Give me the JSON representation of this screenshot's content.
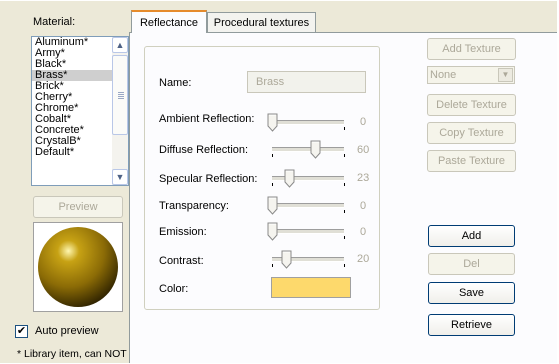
{
  "material": {
    "label": "Material:",
    "items": [
      {
        "label": "Aluminum*",
        "selected": false
      },
      {
        "label": "Army*",
        "selected": false
      },
      {
        "label": "Black*",
        "selected": false
      },
      {
        "label": "Brass*",
        "selected": true
      },
      {
        "label": "Brick*",
        "selected": false
      },
      {
        "label": "Cherry*",
        "selected": false
      },
      {
        "label": "Chrome*",
        "selected": false
      },
      {
        "label": "Cobalt*",
        "selected": false
      },
      {
        "label": "Concrete*",
        "selected": false
      },
      {
        "label": "CrystalB*",
        "selected": false
      },
      {
        "label": "Default*",
        "selected": false
      }
    ]
  },
  "preview": {
    "button": "Preview",
    "sphere_color": "#c7a214",
    "auto_preview_label": "Auto preview",
    "auto_preview_checked": true
  },
  "footnote": "* Library item, can NOT be edited.",
  "tabs": [
    {
      "label": "Reflectance",
      "active": true
    },
    {
      "label": "Procedural textures",
      "active": false
    }
  ],
  "reflectance": {
    "name_label": "Name:",
    "name_value": "Brass",
    "sliders": [
      {
        "label": "Ambient Reflection:",
        "value": "0",
        "fraction": 0.0
      },
      {
        "label": "Diffuse Reflection:",
        "value": "60",
        "fraction": 0.6
      },
      {
        "label": "Specular Reflection:",
        "value": "23",
        "fraction": 0.23
      },
      {
        "label": "Transparency:",
        "value": "0",
        "fraction": 0.0
      },
      {
        "label": "Emission:",
        "value": "0",
        "fraction": 0.0
      },
      {
        "label": "Contrast:",
        "value": "20",
        "fraction": 0.2
      }
    ],
    "color_label": "Color:",
    "color_value": "#fdd96c"
  },
  "texture": {
    "add": "Add Texture",
    "select_value": "None",
    "delete": "Delete Texture",
    "copy": "Copy Texture",
    "paste": "Paste Texture"
  },
  "actions": {
    "add": "Add",
    "del": "Del",
    "save": "Save",
    "retrieve": "Retrieve"
  }
}
